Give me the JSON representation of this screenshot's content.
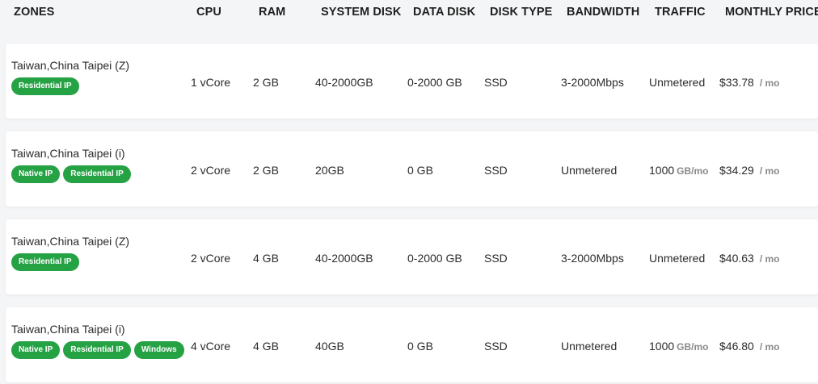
{
  "headers": {
    "zones": "ZONES",
    "cpu": "CPU",
    "ram": "RAM",
    "system_disk": "SYSTEM DISK",
    "data_disk": "DATA DISK",
    "disk_type": "DISK TYPE",
    "bandwidth": "BANDWIDTH",
    "traffic": "TRAFFIC",
    "monthly_price": "MONTHLY PRICE"
  },
  "rows": [
    {
      "zone": "Taiwan,China Taipei (Z)",
      "badges": [
        "Residential IP"
      ],
      "cpu": "1 vCore",
      "ram": "2 GB",
      "system_disk": "40-2000GB",
      "data_disk": "0-2000 GB",
      "disk_type": "SSD",
      "bandwidth": "3-2000Mbps",
      "traffic": "Unmetered",
      "traffic_unit": "",
      "price": "$33.78",
      "price_unit": "/ mo"
    },
    {
      "zone": "Taiwan,China Taipei (i)",
      "badges": [
        "Native IP",
        "Residential IP"
      ],
      "cpu": "2 vCore",
      "ram": "2 GB",
      "system_disk": "20GB",
      "data_disk": "0 GB",
      "disk_type": "SSD",
      "bandwidth": "Unmetered",
      "traffic": "1000",
      "traffic_unit": "GB/mo",
      "price": "$34.29",
      "price_unit": "/ mo"
    },
    {
      "zone": "Taiwan,China Taipei (Z)",
      "badges": [
        "Residential IP"
      ],
      "cpu": "2 vCore",
      "ram": "4 GB",
      "system_disk": "40-2000GB",
      "data_disk": "0-2000 GB",
      "disk_type": "SSD",
      "bandwidth": "3-2000Mbps",
      "traffic": "Unmetered",
      "traffic_unit": "",
      "price": "$40.63",
      "price_unit": "/ mo"
    },
    {
      "zone": "Taiwan,China Taipei (i)",
      "badges": [
        "Native IP",
        "Residential IP",
        "Windows"
      ],
      "cpu": "4 vCore",
      "ram": "4 GB",
      "system_disk": "40GB",
      "data_disk": "0 GB",
      "disk_type": "SSD",
      "bandwidth": "Unmetered",
      "traffic": "1000",
      "traffic_unit": "GB/mo",
      "price": "$46.80",
      "price_unit": "/ mo"
    }
  ],
  "colors": {
    "badge": "#25a244",
    "row_bg": "#ffffff",
    "page_bg": "#f4f5f7",
    "muted": "#8a8a8a"
  }
}
